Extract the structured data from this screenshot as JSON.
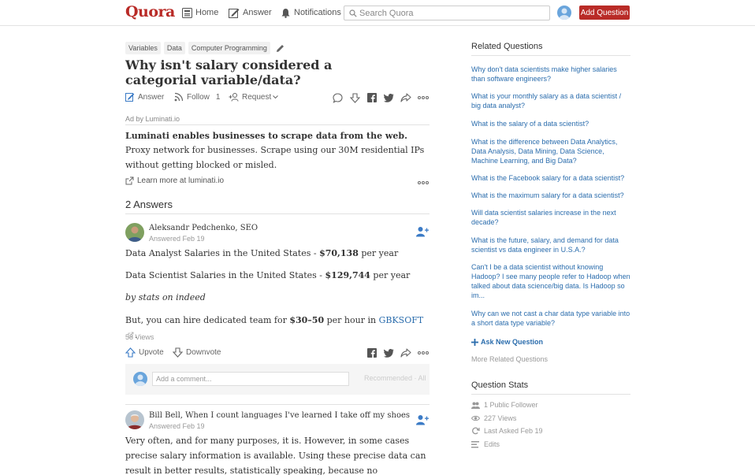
{
  "header": {
    "logo": "Quora",
    "nav": [
      {
        "label": "Home",
        "icon": "home-icon"
      },
      {
        "label": "Answer",
        "icon": "pencil-square-icon"
      },
      {
        "label": "Notifications",
        "icon": "bell-icon"
      }
    ],
    "search_placeholder": "Search Quora",
    "add_question": "Add Question"
  },
  "question": {
    "topics": [
      "Variables",
      "Data",
      "Computer Programming"
    ],
    "title": "Why isn't salary considered a categorial variable/data?",
    "actions": {
      "answer": "Answer",
      "follow": "Follow",
      "follow_count": "1",
      "request": "Request"
    }
  },
  "ad": {
    "label": "Ad by Luminati.io",
    "title": "Luminati enables businesses to scrape data from the web.",
    "body": "Proxy network for businesses. Scrape using our 30M residential IPs without getting blocked or misled.",
    "link": "Learn more at luminati.io"
  },
  "answers_count": "2 Answers",
  "answers": [
    {
      "author": "Aleksandr Pedchenko, SEO",
      "date": "Answered Feb 19",
      "lines": [
        {
          "prefix": "Data Analyst Salaries in the United States - ",
          "bold": "$70,138",
          "suffix": " per year"
        },
        {
          "prefix": "Data Scientist Salaries in the United States - ",
          "bold": "$129,744",
          "suffix": " per year"
        }
      ],
      "italic": "by stats on indeed",
      "hire": {
        "prefix": "But, you can hire dedicated team for ",
        "bold": "$30–50",
        "middle": " per hour in ",
        "link": "GBKSOFT",
        "suffix": "."
      },
      "views": "58 Views",
      "upvote": "Upvote",
      "downvote": "Downvote",
      "comment_placeholder": "Add a comment...",
      "comment_sort": "Recommended · All"
    },
    {
      "author": "Bill Bell, When I count languages I've learned I take off my shoes",
      "date": "Answered Feb 19",
      "text": "Very often, and for many purposes, it is. However, in some cases precise salary information is available. Using these precise data can result in better results, statistically speaking, because no information is discarded."
    }
  ],
  "sidebar": {
    "related_title": "Related Questions",
    "related": [
      "Why don't data scientists make higher salaries than software engineers?",
      "What is your monthly salary as a data scientist / big data analyst?",
      "What is the salary of a data scientist?",
      "What is the difference between Data Analytics, Data Analysis, Data Mining, Data Science, Machine Learning, and Big Data?",
      "What is the Facebook salary for a data scientist?",
      "What is the maximum salary for a data scientist?",
      "Will data scientist salaries increase in the next decade?",
      "What is the future, salary, and demand for data scientist vs data engineer in U.S.A.?",
      "Can't I be a data scientist without knowing Hadoop? I see many people refer to Hadoop when talked about data science/big data. Is Hadoop so im...",
      "Why can we not cast a char data type variable into a short data type variable?"
    ],
    "ask_new": "Ask New Question",
    "more_related": "More Related Questions",
    "stats_title": "Question Stats",
    "stats": [
      {
        "icon": "followers-icon",
        "label": "1 Public Follower"
      },
      {
        "icon": "eye-icon",
        "label": "227 Views"
      },
      {
        "icon": "refresh-icon",
        "label": "Last Asked Feb 19"
      },
      {
        "icon": "edits-icon",
        "label": "Edits"
      }
    ]
  },
  "colors": {
    "brand": "#b92b27",
    "link": "#2b6dad"
  }
}
